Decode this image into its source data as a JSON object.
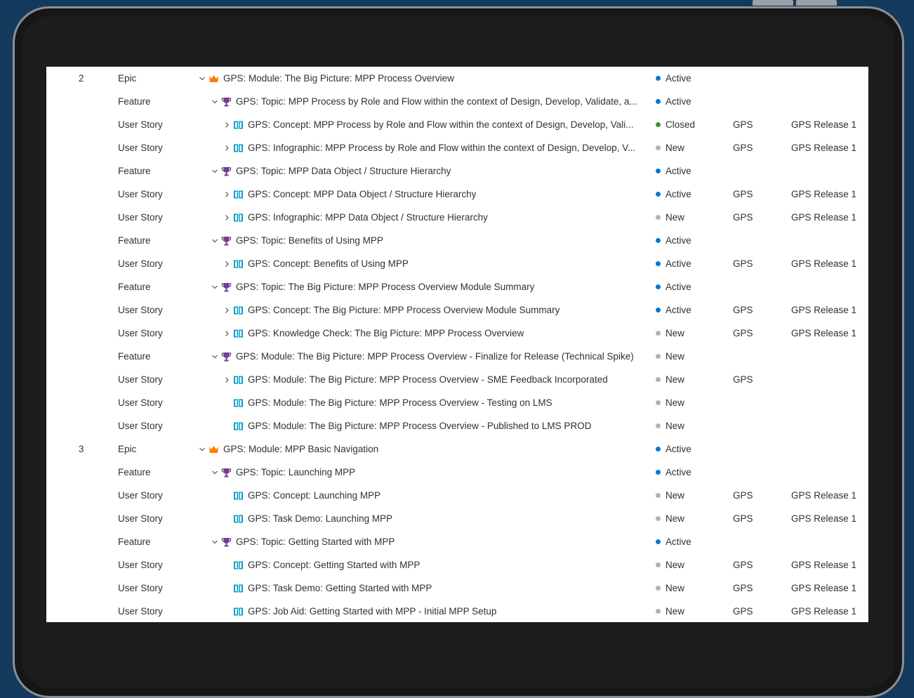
{
  "colors": {
    "active": "#0078d4",
    "closed": "#339933",
    "new": "#b2b2b2",
    "epic": "#ff7b00",
    "feature": "#773b93",
    "story": "#009ccc"
  },
  "rows": [
    {
      "num": "2",
      "type": "Epic",
      "level": 0,
      "chevron": "down",
      "icon": "crown-icon",
      "title": "GPS: Module: The Big Picture: MPP Process Overview",
      "state": "Active",
      "area": "",
      "iteration": ""
    },
    {
      "num": "",
      "type": "Feature",
      "level": 1,
      "chevron": "down",
      "icon": "trophy-icon",
      "title": "GPS: Topic: MPP Process by Role and Flow within the context of Design, Develop, Validate, a...",
      "state": "Active",
      "area": "",
      "iteration": ""
    },
    {
      "num": "",
      "type": "User Story",
      "level": 2,
      "chevron": "right",
      "icon": "book-icon",
      "title": "GPS: Concept: MPP Process by Role and Flow within the context of Design, Develop, Vali...",
      "state": "Closed",
      "area": "GPS",
      "iteration": "GPS Release 1"
    },
    {
      "num": "",
      "type": "User Story",
      "level": 2,
      "chevron": "right",
      "icon": "book-icon",
      "title": "GPS: Infographic: MPP Process by Role and Flow within the context of Design, Develop, V...",
      "state": "New",
      "area": "GPS",
      "iteration": "GPS Release 1"
    },
    {
      "num": "",
      "type": "Feature",
      "level": 1,
      "chevron": "down",
      "icon": "trophy-icon",
      "title": "GPS: Topic: MPP Data Object / Structure Hierarchy",
      "state": "Active",
      "area": "",
      "iteration": ""
    },
    {
      "num": "",
      "type": "User Story",
      "level": 2,
      "chevron": "right",
      "icon": "book-icon",
      "title": "GPS: Concept: MPP Data Object / Structure Hierarchy",
      "state": "Active",
      "area": "GPS",
      "iteration": "GPS Release 1"
    },
    {
      "num": "",
      "type": "User Story",
      "level": 2,
      "chevron": "right",
      "icon": "book-icon",
      "title": "GPS: Infographic: MPP Data Object / Structure Hierarchy",
      "state": "New",
      "area": "GPS",
      "iteration": "GPS Release 1"
    },
    {
      "num": "",
      "type": "Feature",
      "level": 1,
      "chevron": "down",
      "icon": "trophy-icon",
      "title": "GPS: Topic: Benefits of Using MPP",
      "state": "Active",
      "area": "",
      "iteration": ""
    },
    {
      "num": "",
      "type": "User Story",
      "level": 2,
      "chevron": "right",
      "icon": "book-icon",
      "title": "GPS: Concept: Benefits of Using MPP",
      "state": "Active",
      "area": "GPS",
      "iteration": "GPS Release 1"
    },
    {
      "num": "",
      "type": "Feature",
      "level": 1,
      "chevron": "down",
      "icon": "trophy-icon",
      "title": "GPS: Topic: The Big Picture: MPP Process Overview Module Summary",
      "state": "Active",
      "area": "",
      "iteration": ""
    },
    {
      "num": "",
      "type": "User Story",
      "level": 2,
      "chevron": "right",
      "icon": "book-icon",
      "title": "GPS: Concept: The Big Picture: MPP Process Overview Module Summary",
      "state": "Active",
      "area": "GPS",
      "iteration": "GPS Release 1"
    },
    {
      "num": "",
      "type": "User Story",
      "level": 2,
      "chevron": "right",
      "icon": "book-icon",
      "title": "GPS: Knowledge Check: The Big Picture: MPP Process Overview",
      "state": "New",
      "area": "GPS",
      "iteration": "GPS Release 1"
    },
    {
      "num": "",
      "type": "Feature",
      "level": 1,
      "chevron": "down",
      "icon": "trophy-icon",
      "title": "GPS: Module: The Big Picture: MPP Process Overview - Finalize for Release (Technical Spike)",
      "state": "New",
      "area": "",
      "iteration": ""
    },
    {
      "num": "",
      "type": "User Story",
      "level": 2,
      "chevron": "right",
      "icon": "book-icon",
      "title": "GPS: Module: The Big Picture: MPP Process Overview - SME Feedback Incorporated",
      "state": "New",
      "area": "GPS",
      "iteration": ""
    },
    {
      "num": "",
      "type": "User Story",
      "level": 2,
      "chevron": "",
      "icon": "book-icon",
      "title": "GPS: Module: The Big Picture: MPP Process Overview - Testing on LMS",
      "state": "New",
      "area": "",
      "iteration": ""
    },
    {
      "num": "",
      "type": "User Story",
      "level": 2,
      "chevron": "",
      "icon": "book-icon",
      "title": "GPS: Module: The Big Picture: MPP Process Overview - Published to LMS PROD",
      "state": "New",
      "area": "",
      "iteration": ""
    },
    {
      "num": "3",
      "type": "Epic",
      "level": 0,
      "chevron": "down",
      "icon": "crown-icon",
      "title": "GPS: Module: MPP Basic Navigation",
      "state": "Active",
      "area": "",
      "iteration": ""
    },
    {
      "num": "",
      "type": "Feature",
      "level": 1,
      "chevron": "down",
      "icon": "trophy-icon",
      "title": "GPS: Topic: Launching MPP",
      "state": "Active",
      "area": "",
      "iteration": ""
    },
    {
      "num": "",
      "type": "User Story",
      "level": 2,
      "chevron": "",
      "icon": "book-icon",
      "title": "GPS: Concept: Launching MPP",
      "state": "New",
      "area": "GPS",
      "iteration": "GPS Release 1"
    },
    {
      "num": "",
      "type": "User Story",
      "level": 2,
      "chevron": "",
      "icon": "book-icon",
      "title": "GPS: Task Demo: Launching MPP",
      "state": "New",
      "area": "GPS",
      "iteration": "GPS Release 1"
    },
    {
      "num": "",
      "type": "Feature",
      "level": 1,
      "chevron": "down",
      "icon": "trophy-icon",
      "title": "GPS: Topic: Getting Started with MPP",
      "state": "Active",
      "area": "",
      "iteration": ""
    },
    {
      "num": "",
      "type": "User Story",
      "level": 2,
      "chevron": "",
      "icon": "book-icon",
      "title": "GPS: Concept: Getting Started with MPP",
      "state": "New",
      "area": "GPS",
      "iteration": "GPS Release 1"
    },
    {
      "num": "",
      "type": "User Story",
      "level": 2,
      "chevron": "",
      "icon": "book-icon",
      "title": "GPS: Task Demo: Getting Started with MPP",
      "state": "New",
      "area": "GPS",
      "iteration": "GPS Release 1"
    },
    {
      "num": "",
      "type": "User Story",
      "level": 2,
      "chevron": "",
      "icon": "book-icon",
      "title": "GPS: Job Aid: Getting Started with MPP - Initial MPP Setup",
      "state": "New",
      "area": "GPS",
      "iteration": "GPS Release 1"
    }
  ]
}
